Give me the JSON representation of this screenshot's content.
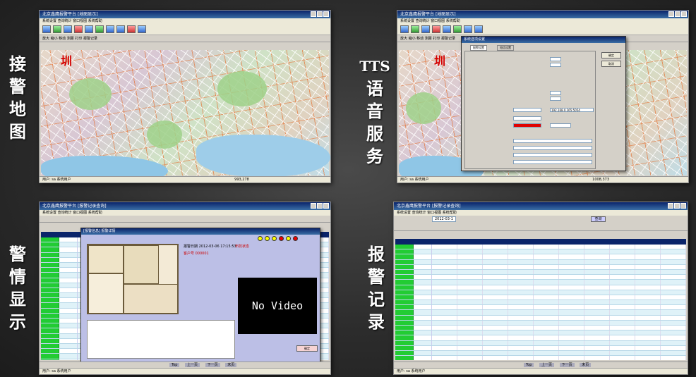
{
  "labels": {
    "map": "接警地图",
    "tts_prefix": "TTS",
    "tts_rest": "语音服务",
    "alarm": "警情显示",
    "records": "报警记录"
  },
  "app": {
    "title": "北京鑫鹰报警平台",
    "map_tab": "[地图显示]",
    "records_tab": "[报警记录查询]",
    "menu": "系统设置  查询统计  窗口视图  系统帮助",
    "subbar_map": "放大  缩小  移动  测距  打印  报警记录",
    "status_user": "用户: sa 系统用户",
    "status_coord": "993,278",
    "status_coord2": "1008,373",
    "city": "圳",
    "tts_dialog_title": "系统选项设置",
    "tts_tab1": "报警设置",
    "tts_tab2": "短信设置",
    "tts_ip": "192.168.0.165:5054",
    "tts_ok": "确定",
    "tts_cancel": "取消",
    "alarm_dialog_title": "[报警信息] 报警详情",
    "no_video": "No Video",
    "alarm_status": "报警日期 2012-03-06 17:15:53",
    "alarm_type": "布防状态",
    "alarm_user": "客户号 000001",
    "alarm_confirm": "确定",
    "records_query": "查询",
    "records_date": "2012-03-1",
    "pager": [
      "Top",
      "上一页",
      "下一页",
      "末页"
    ]
  },
  "colors": {
    "status_green": "#22cc33",
    "title_blue": "#0a246a"
  }
}
